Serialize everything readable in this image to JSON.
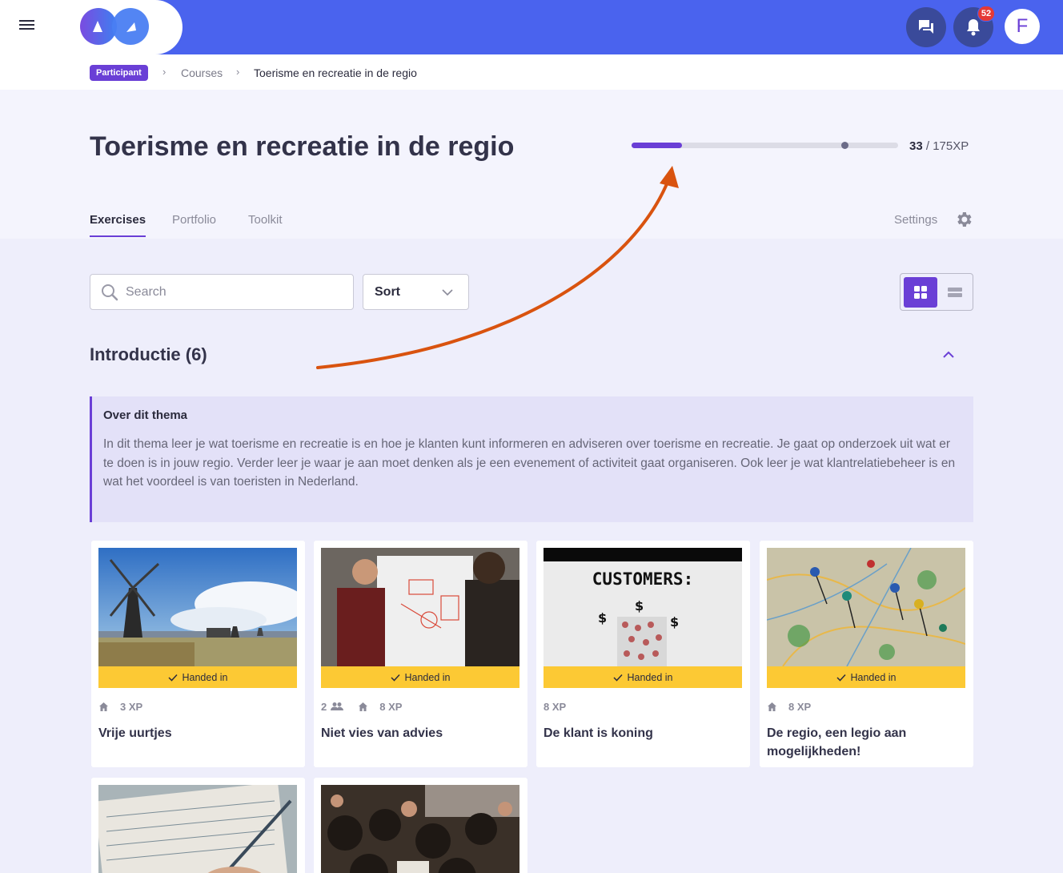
{
  "topbar": {
    "notifications_count": "52",
    "avatar_initial": "F"
  },
  "breadcrumb": {
    "role": "Participant",
    "courses": "Courses",
    "current": "Toerisme en recreatie in de regio"
  },
  "header": {
    "title": "Toerisme en recreatie in de regio",
    "xp_current": "33",
    "xp_total": " / 175XP",
    "xp_progress_fraction": 0.189,
    "xp_marker_fraction": 0.8,
    "tabs": [
      "Exercises",
      "Portfolio",
      "Toolkit"
    ],
    "settings": "Settings"
  },
  "filters": {
    "search_placeholder": "Search",
    "sort_label": "Sort"
  },
  "section": {
    "title": "Introductie (6)",
    "info_title": "Over dit thema",
    "info_text": "In dit thema leer je wat toerisme en recreatie is en hoe je klanten kunt informeren en adviseren over toerisme en recreatie. Je gaat op onderzoek uit wat er te doen is in jouw regio. Verder leer je waar je aan moet denken als je een evenement of activiteit gaat organiseren. Ook leer je wat klantrelatiebeheer is en wat het voordeel is van toeristen in Nederland."
  },
  "cards": [
    {
      "title": "Vrije uurtjes",
      "status": "Handed in",
      "group_size": "",
      "xp": "3 XP",
      "home_icon": true
    },
    {
      "title": "Niet vies van advies",
      "status": "Handed in",
      "group_size": "2",
      "xp": "8 XP",
      "home_icon": true
    },
    {
      "title": "De klant is koning",
      "status": "Handed in",
      "group_size": "",
      "xp": "8 XP",
      "home_icon": false,
      "image_text": "CUSTOMERS:"
    },
    {
      "title": "De regio, een legio aan mogelijkheden!",
      "status": "Handed in",
      "group_size": "",
      "xp": "8 XP",
      "home_icon": true
    }
  ],
  "colors": {
    "topbar": "#4a63ee",
    "accent": "#6a3fd6",
    "status_yellow": "#fcc934",
    "annotation_arrow": "#d9530f"
  }
}
